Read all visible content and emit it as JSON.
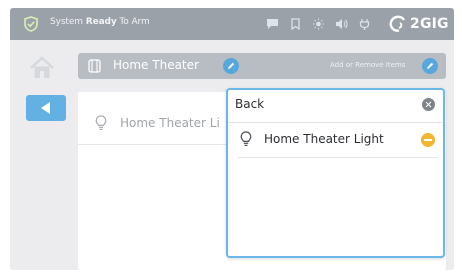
{
  "status_bar": {
    "status_prefix": "System ",
    "status_bold": "Ready",
    "status_suffix": " To Arm",
    "icons": [
      "message-icon",
      "bookmark-icon",
      "brightness-icon",
      "volume-icon",
      "plug-icon"
    ],
    "brand": "2GIG",
    "colors": {
      "bar": "#9aa1a9",
      "text": "#f2f3f5"
    }
  },
  "breadcrumb": {
    "title": "Home Theater",
    "right_label": "Add or Remove Items"
  },
  "content": {
    "items": [
      {
        "label": "Home Theater Li"
      }
    ]
  },
  "popup": {
    "back_label": "Back",
    "items": [
      {
        "label": "Home Theater Light",
        "action_icon": "remove-icon"
      }
    ],
    "colors": {
      "border": "#6bb8e6",
      "remove": "#f1b632",
      "close": "#7f848b"
    }
  },
  "accent": "#57a7dc"
}
